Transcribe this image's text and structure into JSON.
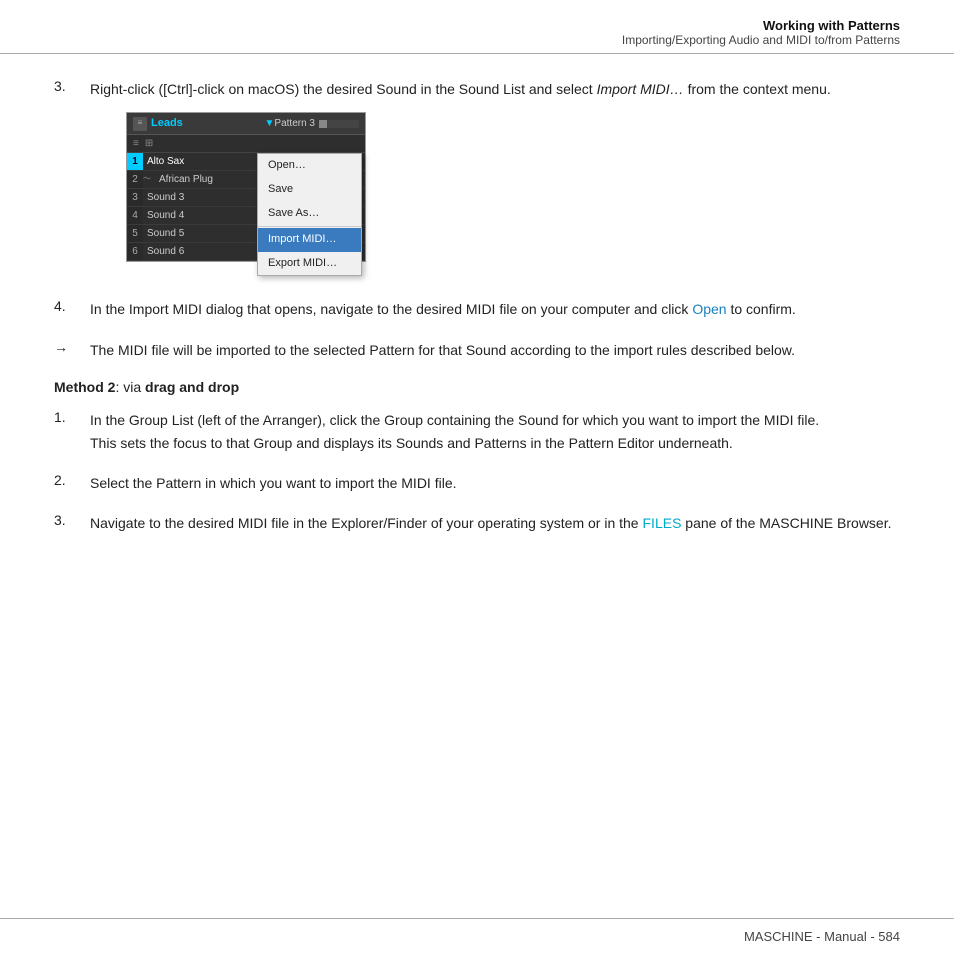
{
  "header": {
    "title": "Working with Patterns",
    "subtitle": "Importing/Exporting Audio and MIDI to/from Patterns"
  },
  "footer": {
    "text": "MASCHINE - Manual - 584"
  },
  "steps": {
    "step3_prefix": "3.",
    "step3_text": "Right-click ([Ctrl]-click on macOS) the desired Sound in the Sound List and select ",
    "step3_italic": "Import MIDI…",
    "step3_suffix": " from the context menu.",
    "step4_prefix": "4.",
    "step4_text": "In the Import MIDI dialog that opens, navigate to the desired MIDI file on your computer and click ",
    "step4_link": "Open",
    "step4_suffix": " to confirm.",
    "arrow_prefix": "→",
    "arrow_text": "The MIDI file will be imported to the selected Pattern for that Sound according to the import rules described below.",
    "method_label": "Method 2",
    "method_colon": ": via ",
    "method_bold": "drag and drop",
    "method2_step1_prefix": "1.",
    "method2_step1_text": "In the Group List (left of the Arranger), click the Group containing the Sound for which you want to import the MIDI file.\nThis sets the focus to that Group and displays its Sounds and Patterns in the Pattern Editor underneath.",
    "method2_step2_prefix": "2.",
    "method2_step2_text": "Select the Pattern in which you want to import the MIDI file.",
    "method2_step3_prefix": "3.",
    "method2_step3_text": "Navigate to the desired MIDI file in the Explorer/Finder of your operating system or in the ",
    "method2_step3_link": "FILES",
    "method2_step3_suffix": " pane of the MASCHINE Browser."
  },
  "ui": {
    "leads_label": "Leads",
    "dropdown_arrow": "▼",
    "pattern_label": "Pattern 3",
    "rows": [
      {
        "num": "1",
        "name": "Alto Sax",
        "active": true
      },
      {
        "num": "2",
        "name": "African Plug",
        "active": false
      },
      {
        "num": "3",
        "name": "Sound 3",
        "active": false
      },
      {
        "num": "4",
        "name": "Sound 4",
        "active": false
      },
      {
        "num": "5",
        "name": "Sound 5",
        "active": false
      },
      {
        "num": "6",
        "name": "Sound 6",
        "active": false
      }
    ],
    "context_menu": {
      "items": [
        {
          "label": "Open…",
          "active": false
        },
        {
          "label": "Save",
          "active": false
        },
        {
          "label": "Save As…",
          "active": false
        },
        {
          "label": "Import MIDI…",
          "active": true
        },
        {
          "label": "Export MIDI…",
          "active": false
        }
      ]
    }
  },
  "colors": {
    "link_blue": "#1a7fbf",
    "link_cyan": "#00aacc",
    "active_row_bg": "#00ccff",
    "active_menu_bg": "#3a7bbf"
  }
}
